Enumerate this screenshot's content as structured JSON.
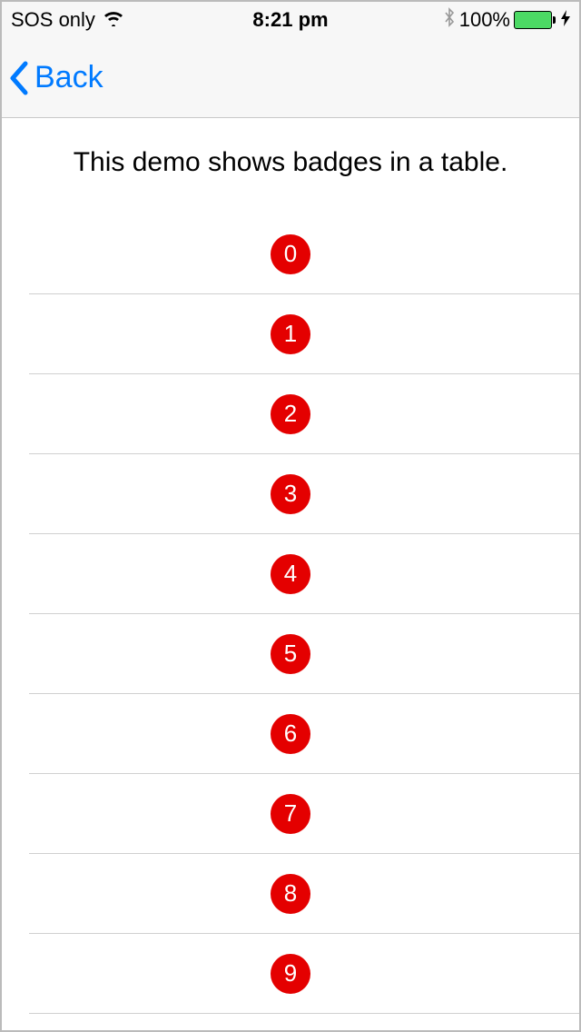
{
  "statusBar": {
    "carrier": "SOS only",
    "time": "8:21 pm",
    "batteryPercent": "100%"
  },
  "nav": {
    "backLabel": "Back"
  },
  "header": {
    "title": "This demo shows badges in a table."
  },
  "table": {
    "rows": [
      {
        "badge": "0"
      },
      {
        "badge": "1"
      },
      {
        "badge": "2"
      },
      {
        "badge": "3"
      },
      {
        "badge": "4"
      },
      {
        "badge": "5"
      },
      {
        "badge": "6"
      },
      {
        "badge": "7"
      },
      {
        "badge": "8"
      },
      {
        "badge": "9"
      }
    ]
  },
  "colors": {
    "badge": "#e40000",
    "tint": "#007aff",
    "batteryFill": "#4cd964"
  }
}
